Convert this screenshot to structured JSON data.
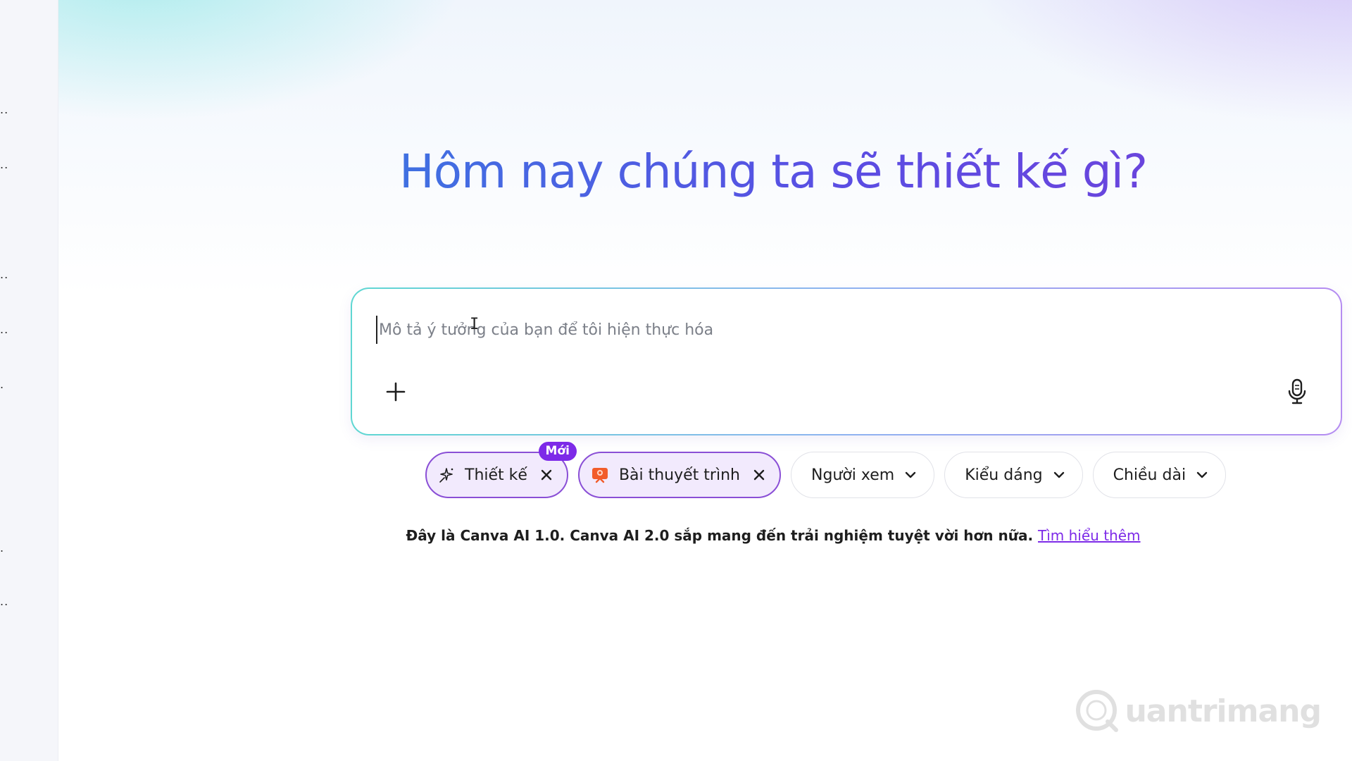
{
  "headline": "Hôm nay chúng ta sẽ thiết kế gì?",
  "prompt": {
    "placeholder": "Mô tả ý tưởng của bạn để tôi hiện thực hóa",
    "value": "",
    "add_icon": "plus-icon",
    "mic_icon": "microphone-icon"
  },
  "chips": {
    "design": {
      "label": "Thiết kế",
      "badge": "Mới",
      "icon": "sparkle-icon"
    },
    "presentation": {
      "label": "Bài thuyết trình",
      "icon": "presentation-icon"
    },
    "audience": {
      "label": "Người xem"
    },
    "style": {
      "label": "Kiểu dáng"
    },
    "length": {
      "label": "Chiều dài"
    }
  },
  "notice": {
    "text": "Đây là Canva AI 1.0. Canva AI 2.0 sắp mang đến trải nghiệm tuyệt vời hơn nữa.",
    "link": "Tìm hiểu thêm"
  },
  "watermark": {
    "logo": "quantrimang-logo",
    "text": "uantrimang"
  },
  "colors": {
    "accent": "#7d2ae8",
    "chip_active_border": "#8a4fd6",
    "chip_active_bg": "#f2eafd",
    "headline_gradient_start": "#2c8be0",
    "headline_gradient_end": "#7b3bd6"
  }
}
